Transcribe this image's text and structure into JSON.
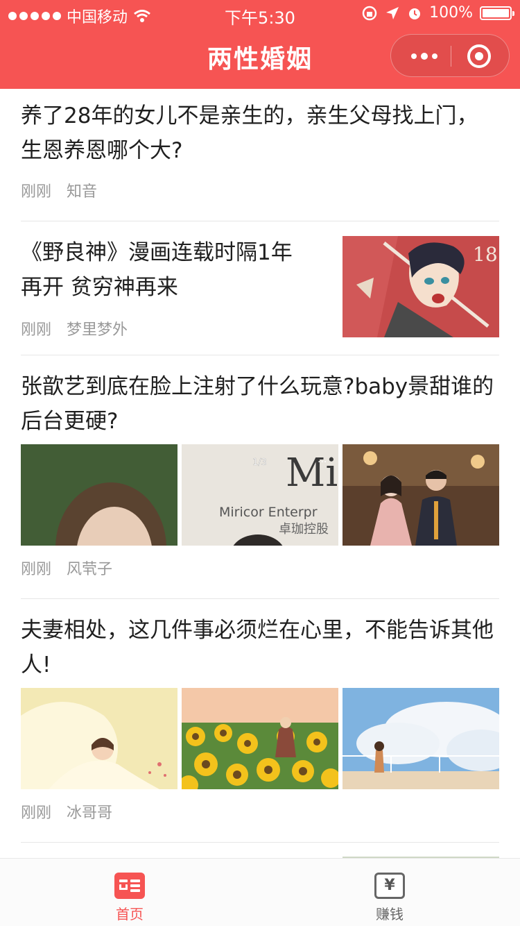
{
  "status_bar": {
    "carrier": "中国移动",
    "time": "下午5:30",
    "battery": "100%"
  },
  "header": {
    "title": "两性婚姻"
  },
  "feed": [
    {
      "headline": "养了28年的女儿不是亲生的，亲生父母找上门，生恩养恩哪个大?",
      "time": "刚刚",
      "author": "知音"
    },
    {
      "headline": "《野良神》漫画连载时隔1年再开 贫穷神再来",
      "time": "刚刚",
      "author": "梦里梦外",
      "image_text": "18"
    },
    {
      "headline": "张歆艺到底在脸上注射了什么玩意?baby景甜谁的后台更硬?",
      "time": "刚刚",
      "author": "风茕子",
      "image_texts": [
        "1/3",
        "Miricor Enterpr",
        "卓珈控股"
      ]
    },
    {
      "headline": "夫妻相处，这几件事必须烂在心里，不能告诉其他人!",
      "time": "刚刚",
      "author": "冰哥哥"
    }
  ],
  "tabbar": {
    "home_label": "首页",
    "earn_label": "赚钱",
    "earn_icon_glyph": "¥",
    "active_color": "#f65453"
  }
}
